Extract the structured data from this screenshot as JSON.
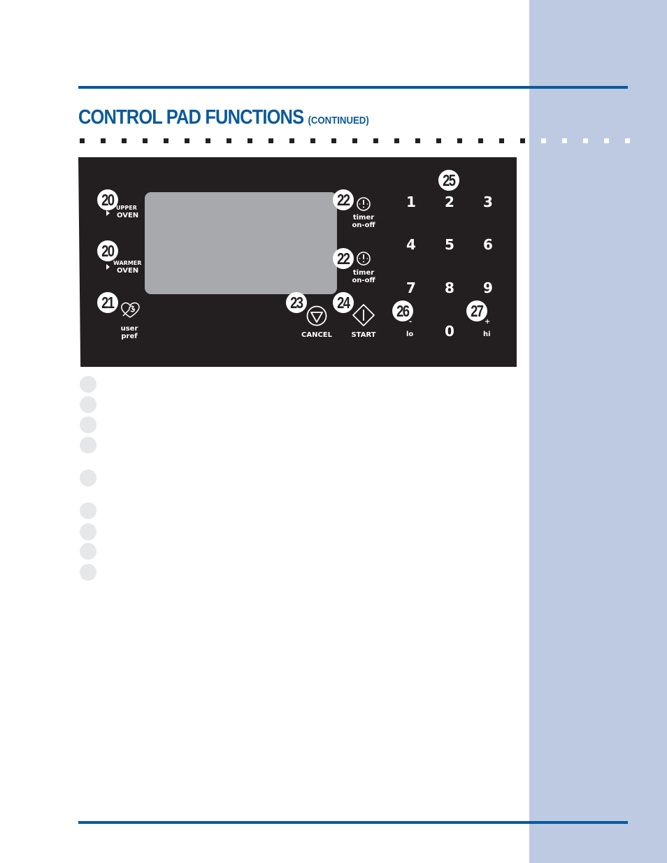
{
  "page": {
    "title": "CONTROL PAD FUNCTIONS",
    "title_suffix": "(CONTINUED)",
    "colors": {
      "accent_blue": "#0a5a9c",
      "sidebar": "#bec9e2",
      "panel": "#231f20",
      "display": "#a7a9ac",
      "callout_placeholder": "#e6e7e8"
    }
  },
  "control_panel": {
    "callouts": {
      "upper_oven": "20",
      "warmer_oven": "20",
      "user_pref": "21",
      "timer_upper": "22",
      "timer_lower": "22",
      "cancel": "23",
      "start": "24",
      "keypad": "25",
      "lo": "26",
      "hi": "27"
    },
    "buttons": {
      "upper_oven": {
        "line1": "UPPER",
        "line2": "OVEN",
        "icon": "wrench-icon"
      },
      "warmer_oven": {
        "line1": "WARMER",
        "line2": "OVEN"
      },
      "user_pref": {
        "line1": "user",
        "line2": "pref",
        "icon": "wrench-heart-icon"
      },
      "timer_upper": {
        "line1": "timer",
        "line2": "on-off",
        "icon": "timer-icon"
      },
      "timer_lower": {
        "line1": "timer",
        "line2": "on-off",
        "icon": "timer-icon"
      },
      "cancel": {
        "label": "CANCEL",
        "icon": "cancel-triangle-icon"
      },
      "start": {
        "label": "START",
        "icon": "start-diamond-icon"
      },
      "lo": {
        "label": "lo",
        "sign": "-"
      },
      "hi": {
        "label": "hi",
        "sign": "+"
      }
    },
    "keypad": [
      "1",
      "2",
      "3",
      "4",
      "5",
      "6",
      "7",
      "8",
      "9",
      "0"
    ]
  },
  "descriptions": {
    "placeholder_count": 9
  }
}
